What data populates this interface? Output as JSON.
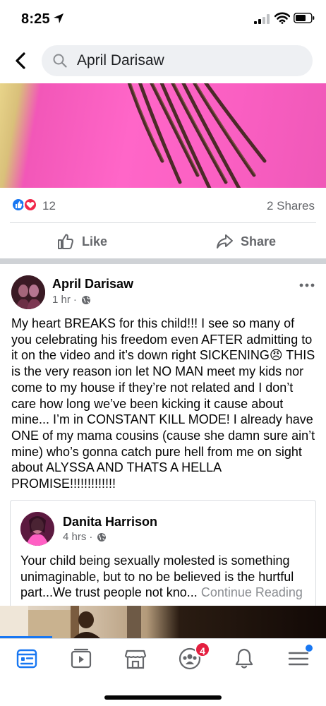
{
  "status_bar": {
    "time": "8:25"
  },
  "search": {
    "query": "April Darisaw"
  },
  "feed_item": {
    "reaction_count": "12",
    "shares": "2 Shares",
    "like_label": "Like",
    "share_label": "Share"
  },
  "post": {
    "author": "April Darisaw",
    "time": "1 hr",
    "separator": "·",
    "text": "My heart BREAKS for this child!!! I see so many of you celebrating his freedom even AFTER admitting to it on the video and it’s down right SICKENING😠 THIS is the very reason ion let NO MAN meet my kids nor come to my house if they’re not related and I don’t care how long we’ve been kicking it cause about mine... I’m in CONSTANT KILL MODE! I already have ONE of my mama cousins (cause she damn sure ain’t mine) who’s gonna catch pure hell from me on sight about ALYSSA AND THATS A HELLA PROMISE!!!!!!!!!!!!!"
  },
  "shared_post": {
    "author": "Danita Harrison",
    "time": "4 hrs",
    "separator": "·",
    "text": "Your child being sexually molested is something unimaginable, but to no be believed is the hurtful part...We trust people not kno...",
    "continue_label": "Continue Reading"
  },
  "bottom_nav": {
    "groups_badge": "4",
    "accent_color": "#1877f2",
    "icons": [
      "news-feed-icon",
      "watch-icon",
      "marketplace-icon",
      "groups-icon",
      "notifications-icon",
      "menu-icon"
    ]
  }
}
